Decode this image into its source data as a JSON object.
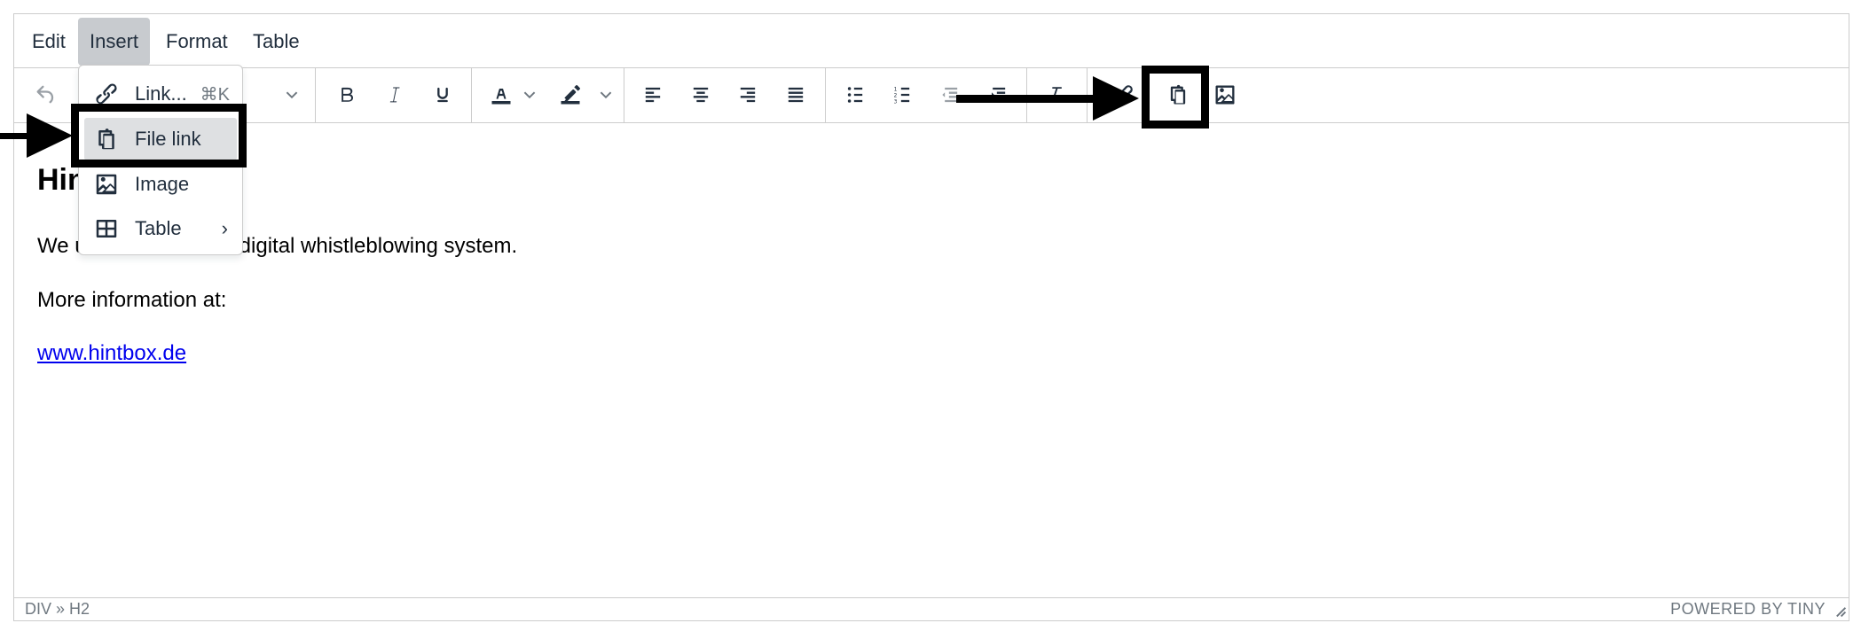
{
  "menubar": {
    "items": [
      {
        "label": "Edit"
      },
      {
        "label": "Insert",
        "active": true
      },
      {
        "label": "Format"
      },
      {
        "label": "Table"
      }
    ]
  },
  "toolbar": {
    "buttons": [
      {
        "name": "undo",
        "icon": "undo-icon",
        "disabled": true
      },
      {
        "name": "block-format-dropdown",
        "icon": "chevron-down-icon"
      },
      {
        "name": "bold",
        "icon": "bold-icon"
      },
      {
        "name": "italic",
        "icon": "italic-icon"
      },
      {
        "name": "underline",
        "icon": "underline-icon"
      },
      {
        "name": "text-color",
        "icon": "text-color-icon"
      },
      {
        "name": "highlight-color",
        "icon": "highlighter-icon"
      },
      {
        "name": "align-left",
        "icon": "align-left-icon"
      },
      {
        "name": "align-center",
        "icon": "align-center-icon"
      },
      {
        "name": "align-right",
        "icon": "align-right-icon"
      },
      {
        "name": "align-justify",
        "icon": "align-justify-icon"
      },
      {
        "name": "bullet-list",
        "icon": "bullet-list-icon"
      },
      {
        "name": "numbered-list",
        "icon": "numbered-list-icon"
      },
      {
        "name": "outdent",
        "icon": "outdent-icon",
        "disabled": true
      },
      {
        "name": "indent",
        "icon": "indent-icon"
      },
      {
        "name": "clear-formatting",
        "icon": "clear-formatting-icon"
      },
      {
        "name": "link",
        "icon": "link-icon"
      },
      {
        "name": "file-link",
        "icon": "clipboard-icon"
      },
      {
        "name": "image",
        "icon": "image-icon"
      }
    ]
  },
  "insert_menu": {
    "items": [
      {
        "label": "Link...",
        "icon": "link-icon",
        "shortcut": "⌘K"
      },
      {
        "label": "File link",
        "icon": "clipboard-icon",
        "highlighted": true
      },
      {
        "label": "Image",
        "icon": "image-icon"
      },
      {
        "label": "Table",
        "icon": "table-icon",
        "submenu_caret": "›"
      }
    ]
  },
  "content": {
    "heading": "Hintbox",
    "paragraph1": "We use Hintbox as a digital whistleblowing system.",
    "paragraph1_visible_prefix": "We",
    "paragraph1_visible_suffix": "a digital whistleblowing system.",
    "paragraph2": "More information at:",
    "link_text": "www.hintbox.de"
  },
  "statusbar": {
    "path": "DIV » H2",
    "branding": "POWERED BY TINY"
  },
  "colors": {
    "text": "#222f3e",
    "border": "#cccccc",
    "menu_active_bg": "#c8cbcf",
    "menu_hover_bg": "#dee0e2",
    "link": "#0000ee",
    "annotation": "#000000",
    "disabled_icon": "#9aa0a6"
  }
}
